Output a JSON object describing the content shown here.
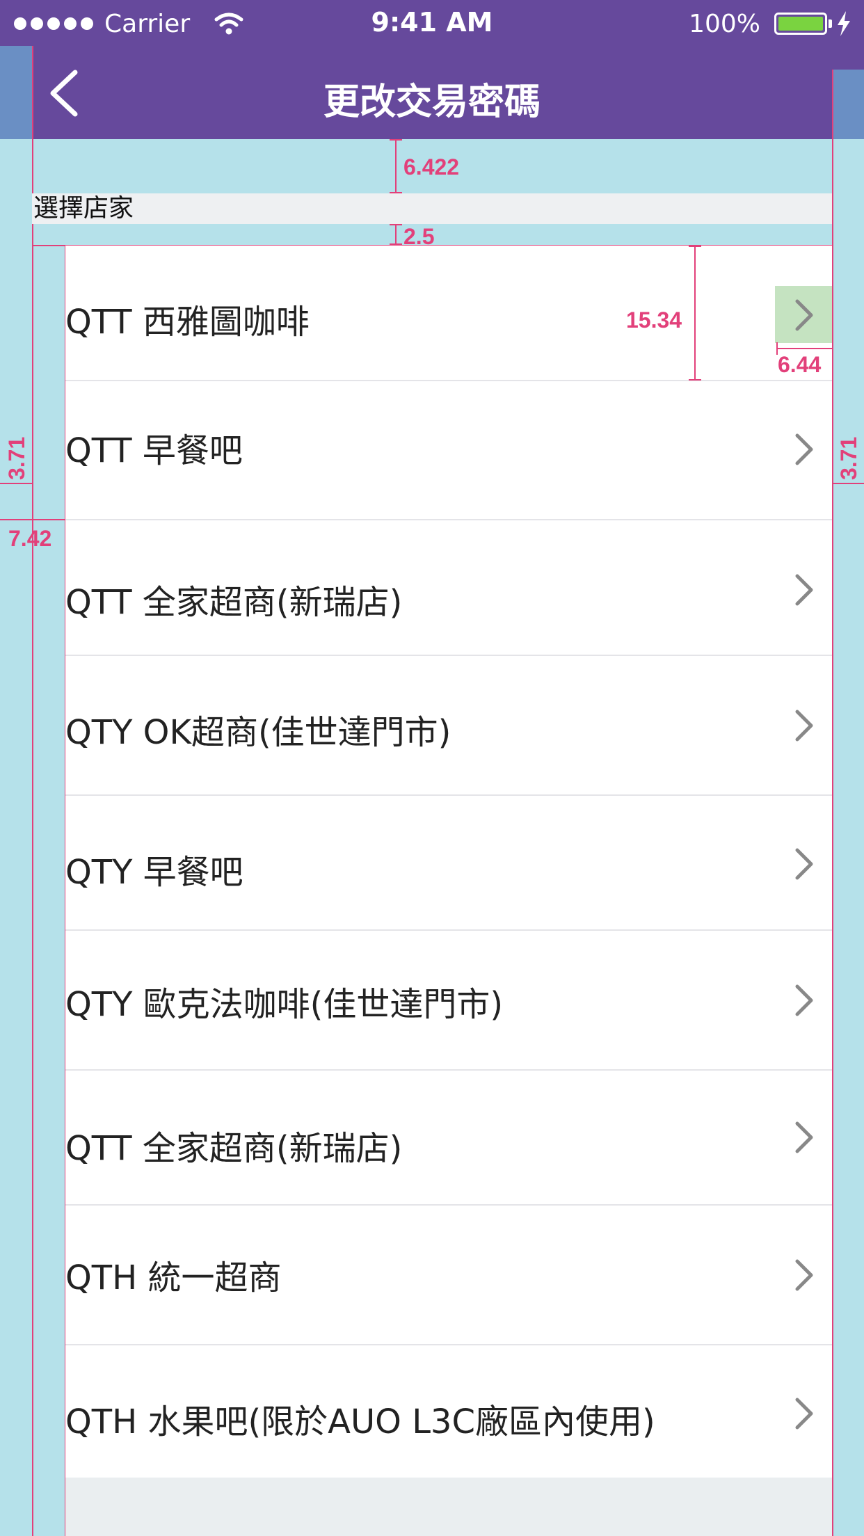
{
  "status_bar": {
    "carrier": "Carrier",
    "time": "9:41 AM",
    "battery": "100%"
  },
  "nav": {
    "title": "更改交易密碼",
    "back_icon": "chevron-left-icon"
  },
  "section": {
    "title": "選擇店家"
  },
  "stores": [
    {
      "label": "QTT 西雅圖咖啡"
    },
    {
      "label": "QTT 早餐吧"
    },
    {
      "label": "QTT 全家超商(新瑞店)"
    },
    {
      "label": "QTY OK超商(佳世達門市)"
    },
    {
      "label": "QTY 早餐吧"
    },
    {
      "label": "QTY 歐克法咖啡(佳世達門市)"
    },
    {
      "label": "QTT 全家超商(新瑞店)"
    },
    {
      "label": "QTH 統一超商"
    },
    {
      "label": "QTH 水果吧(限於AUO L3C廠區內使用)"
    }
  ],
  "measurements": {
    "top_gap": "6.422",
    "header_gap": "2.5",
    "row_height": "15.34",
    "chevron_width": "6.44",
    "side_left": "3.71",
    "side_right": "3.71",
    "inset": "7.42"
  },
  "colors": {
    "nav_bg": "#66499c",
    "guide": "#e2407a",
    "background": "#b5e1ea",
    "battery": "#7ad340"
  }
}
